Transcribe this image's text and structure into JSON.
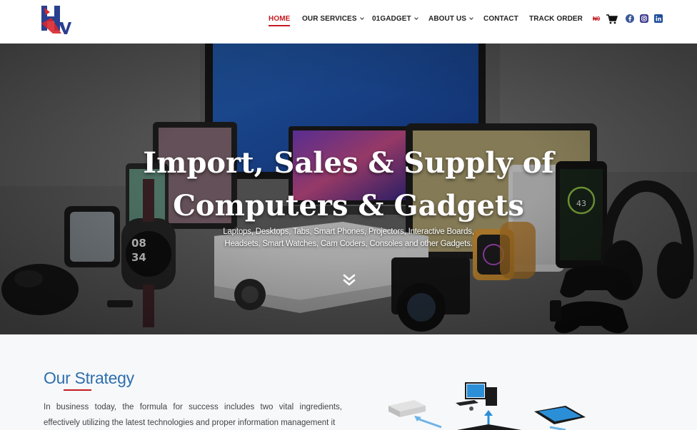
{
  "header": {
    "nav": [
      {
        "label": "HOME",
        "active": true,
        "dropdown": false
      },
      {
        "label": "OUR SERVICES",
        "active": false,
        "dropdown": true
      },
      {
        "label": "01GADGET",
        "active": false,
        "dropdown": true
      },
      {
        "label": "ABOUT US",
        "active": false,
        "dropdown": true
      },
      {
        "label": "CONTACT",
        "active": false,
        "dropdown": false
      },
      {
        "label": "TRACK ORDER",
        "active": false,
        "dropdown": false
      }
    ],
    "cart_amount": "₦0",
    "social": [
      "facebook-icon",
      "instagram-icon",
      "linkedin-icon"
    ]
  },
  "hero": {
    "title_line1": "Import, Sales & Supply of",
    "title_line2": "Computers & Gadgets",
    "subtitle_line1": "Laptops, Desktops, Tabs, Smart Phones, Projectors, Interactive Boards,",
    "subtitle_line2": "Headsets, Smart Watches, Cam Coders, Consoles and other Gadgets."
  },
  "strategy": {
    "title": "Our Strategy",
    "text": "In business today, the formula for success includes two vital ingredients, effectively utilizing the latest technologies and proper information management it"
  },
  "colors": {
    "accent": "#c51b21",
    "heading": "#2f6fad"
  }
}
